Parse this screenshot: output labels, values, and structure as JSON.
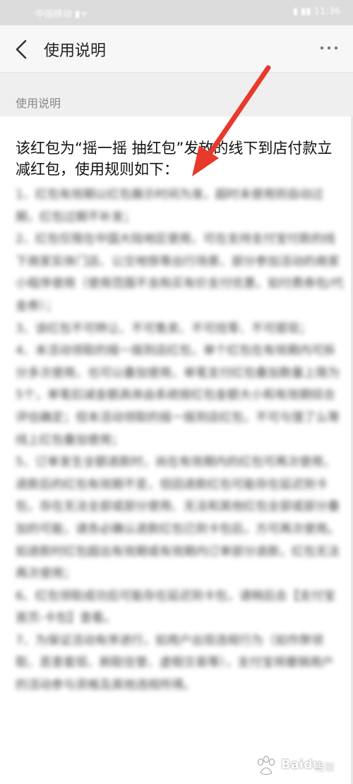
{
  "status_bar": {
    "carrier": "中国移动 ▮ᯤ",
    "time": "▮ ▮▮ 11:36"
  },
  "nav": {
    "title": "使用说明"
  },
  "section_header": "使用说明",
  "intro": "该红包为“摇一摇 抽红包”发放的线下到店付款立减红包，使用规则如下：",
  "rules": [
    "1、红包有效期以红包展示时间为准，超时未使用则自动过期，红包过期不补发；",
    "2、红包仅限在中国大陆地区使用，可在支持支付宝付款的线下商家实体门店、公交地铁等出行场景、部分参加活动的商家小程序使用（使用范围不含购买有价支付优惠，如付费券包/代金券）；",
    "3、该红包不可转让、不可售卖、不可找零、不可提现；",
    "4、本活动领取的摇一摇到店红包，单个红包在有效期内可拆分多次使用，也可以叠加使用，单笔支付红包叠加数量上限为5个，单笔扣减金额具体由系统按红包金额大小和有效期综合评估确定；但本活动领取的摇一摇到店红包，不可与饿了么等线上红包叠加使用；",
    "5、订单发生全额退款时，尚在有效期内的红包可再次使用，退款后的红包有效期不变，但因退款红包可能存在延迟到卡包，存在无法全部或部分使用、无法和其他红包全部或部分叠加的可能，请务必确认退款红包已到卡包后，方可再次使用。如退款时红包超出有效期或有效期内订单部分退款，红包无法再次使用；",
    "6、红包领取成功后可能存在延迟到卡包，请稍后去【支付宝首页-卡包】查看。",
    "7、为保证活动有序进行，如用户出现违规行为（如作弊领取、恶意套现、刷取信誉、虚假交易等），支付宝将撤销用户的活动参与资格及其他违规所得。"
  ],
  "watermark": {
    "brand": "Baidu",
    "sub": "经验"
  },
  "colors": {
    "annotation_arrow": "#e8392b",
    "nav_bg": "#f7f7f7",
    "section_bg": "#efefef"
  }
}
